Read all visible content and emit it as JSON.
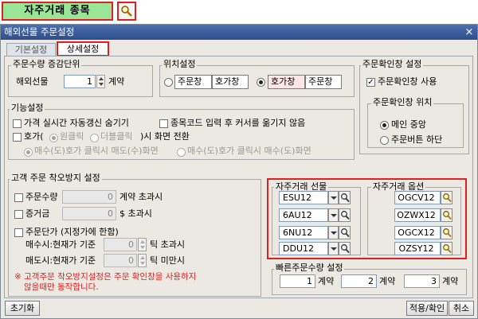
{
  "header": {
    "title": "자주거래 종목"
  },
  "window": {
    "title": "해외선물 주문설정",
    "close": "×"
  },
  "tabs": [
    {
      "label": "기본설정"
    },
    {
      "label": "상세설정"
    }
  ],
  "order_unit": {
    "legend": "주문수량 증감단위",
    "label": "해외선물",
    "value": "1",
    "suffix": "계약"
  },
  "position": {
    "legend": "위치설정",
    "opt1_a": "주문창",
    "opt1_b": "호가창",
    "opt2_a": "호가창",
    "opt2_b": "주문창"
  },
  "confirm": {
    "legend": "주문확인창 설정",
    "use_label": "주문확인창 사용",
    "pos_legend": "주문확인창 위치",
    "pos_opt1": "메인 중앙",
    "pos_opt2": "주문버튼 하단"
  },
  "function": {
    "legend": "기능설정",
    "hide_label": "가격 실시간 자동갱신 숨기기",
    "move_label": "종목코드 입력 후 커서를 옮기지 않음",
    "hoga_label": "호가(",
    "one_click": "원클릭",
    "double_click": "더블클릭",
    "hoga_suffix": ")시 화면 전환",
    "screen_opt1": "매수(도)호가 클릭시 매도(수)화면",
    "screen_opt2": "매수(도)호가 클릭시 매수(도)화면"
  },
  "prevent": {
    "legend": "고객 주문 착오방지 설정",
    "qty_label": "주문수량",
    "qty_value": "0",
    "qty_suffix": "계약 초과시",
    "margin_label": "증거금",
    "margin_value": "0",
    "margin_suffix": "$ 초과시",
    "price_label": "주문단가 (지정가에 한함)",
    "buy_label": "매수시:현재가 기준",
    "buy_value": "0",
    "buy_suffix": "틱 초과시",
    "sell_label": "매도시:현재가 기준",
    "sell_value": "0",
    "sell_suffix": "틱 미만시",
    "warning_line1": "※ 고객주문 착오방지설정은 주문 확인창을 사용하지",
    "warning_line2": "않을때만 동작합니다."
  },
  "futures": {
    "legend": "자주거래 선물",
    "items": [
      "ESU12",
      "6AU12",
      "6NU12",
      "DDU12"
    ]
  },
  "options": {
    "legend": "자주거래 옵션",
    "items": [
      "OGCV12",
      "OZWX12",
      "OGCX12",
      "OZSY12"
    ]
  },
  "quick": {
    "legend": "빠른주문수량 설정",
    "values": [
      "1",
      "2",
      "3"
    ],
    "unit": "계약"
  },
  "buttons": {
    "reset": "초기화",
    "apply": "적용/확인",
    "cancel": "취소"
  }
}
